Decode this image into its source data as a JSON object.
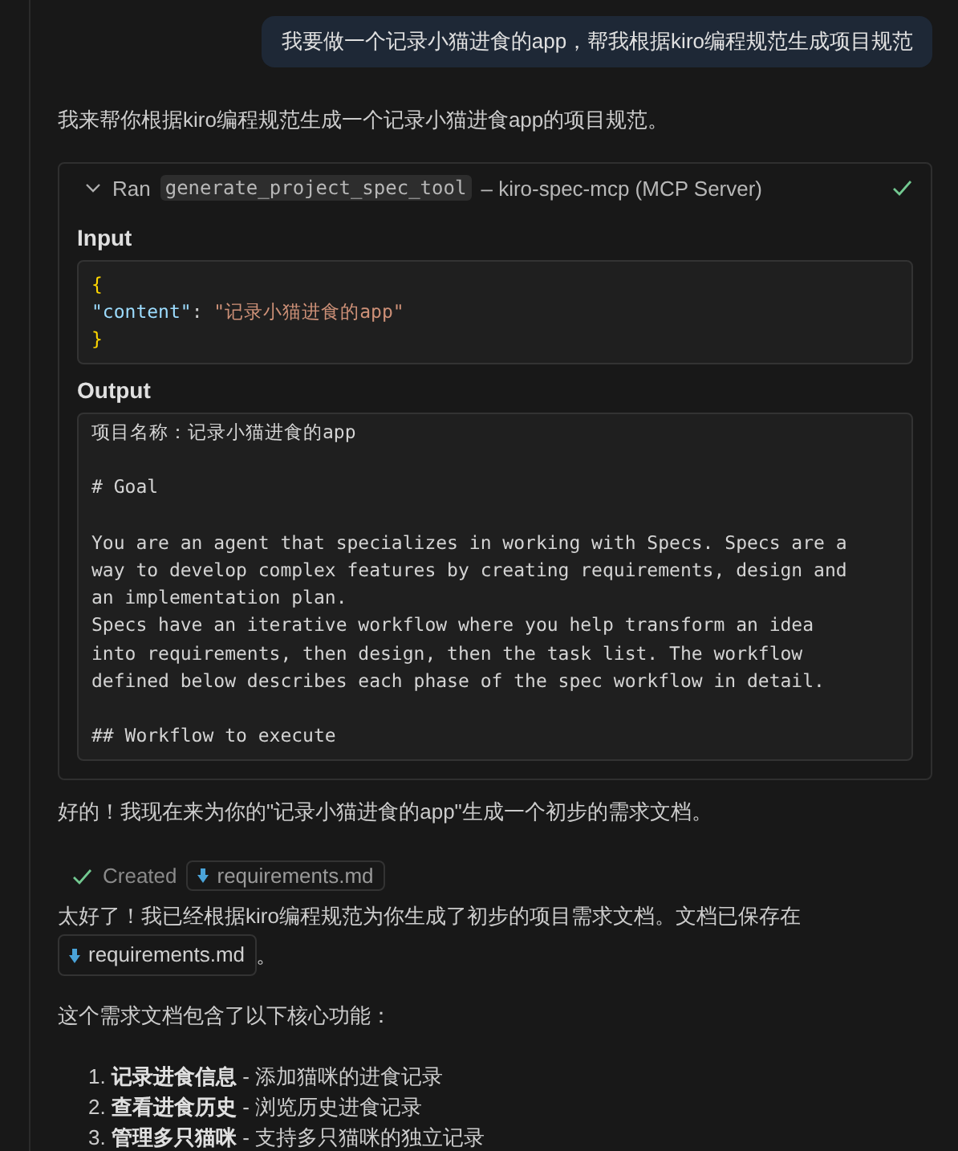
{
  "user_message": "我要做一个记录小猫进食的app，帮我根据kiro编程规范生成项目规范",
  "intro": "我来帮你根据kiro编程规范生成一个记录小猫进食app的项目规范。",
  "tool_call": {
    "expanded": true,
    "success": true,
    "verb": "Ran",
    "tool": "generate_project_spec_tool",
    "separator": "–",
    "server": "kiro-spec-mcp (MCP Server)",
    "input_label": "Input",
    "input_lines": [
      [
        {
          "kind": "brace",
          "text": "{"
        }
      ],
      [
        {
          "kind": "key",
          "text": "\"content\""
        },
        {
          "kind": "plain",
          "text": ": "
        },
        {
          "kind": "string",
          "text": "\"记录小猫进食的app\""
        }
      ],
      [
        {
          "kind": "brace",
          "text": "}"
        }
      ]
    ],
    "output_label": "Output",
    "output_blocks": [
      [
        "项目名称：记录小猫进食的app"
      ],
      [
        "# Goal"
      ],
      [
        "You are an agent that specializes in working with Specs. Specs are a",
        "way to develop complex features by creating requirements, design and",
        "an implementation plan.",
        "Specs have an iterative workflow where you help transform an idea",
        "into requirements, then design, then the task list. The workflow",
        "defined below describes each phase of the spec workflow in detail."
      ],
      [
        "## Workflow to execute"
      ]
    ]
  },
  "reply": "好的！我现在来为你的\"记录小猫进食的app\"生成一个初步的需求文档。",
  "created": {
    "success": true,
    "label": "Created",
    "file": "requirements.md"
  },
  "saved": {
    "text": "太好了！我已经根据kiro编程规范为你生成了初步的项目需求文档。文档已保存在",
    "file": "requirements.md",
    "after": "。"
  },
  "features_intro": "这个需求文档包含了以下核心功能：",
  "features": [
    {
      "number": "1.",
      "title": "记录进食信息",
      "desc": " - 添加猫咪的进食记录"
    },
    {
      "number": "2.",
      "title": "查看进食历史",
      "desc": " - 浏览历史进食记录"
    },
    {
      "number": "3.",
      "title": "管理多只猫咪",
      "desc": " - 支持多只猫咪的独立记录"
    }
  ]
}
